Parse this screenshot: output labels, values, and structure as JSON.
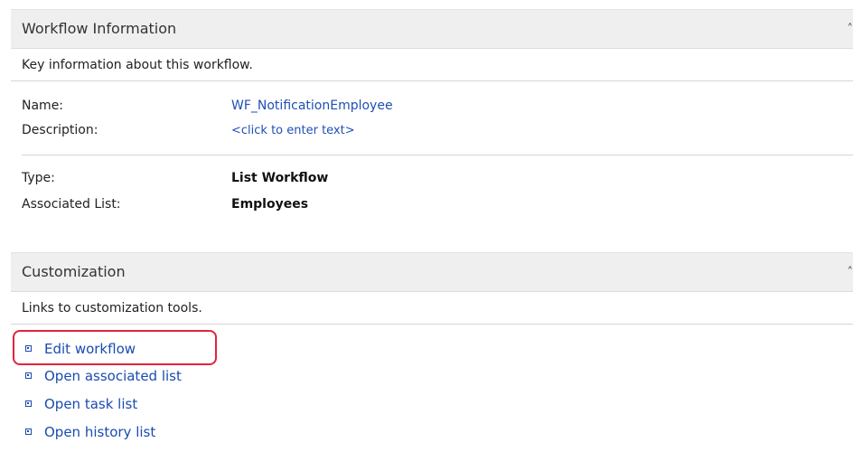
{
  "workflow_section": {
    "title": "Workflow Information",
    "collapse_icon": "chevron-up-icon",
    "description": "Key information about this workflow.",
    "fields": {
      "name_label": "Name:",
      "name_value": "WF_NotificationEmployee",
      "description_label": "Description:",
      "description_value": "<click to enter text>",
      "type_label": "Type:",
      "type_value": "List Workflow",
      "associated_list_label": "Associated List:",
      "associated_list_value": "Employees"
    }
  },
  "customization_section": {
    "title": "Customization",
    "collapse_icon": "chevron-up-icon",
    "description": "Links to customization tools.",
    "links": [
      {
        "label": "Edit workflow"
      },
      {
        "label": "Open associated list"
      },
      {
        "label": "Open task list"
      },
      {
        "label": "Open history list"
      }
    ],
    "highlight_color": "#e0243b"
  },
  "colors": {
    "link": "#1f4fb5",
    "header_bg": "#efefef"
  }
}
